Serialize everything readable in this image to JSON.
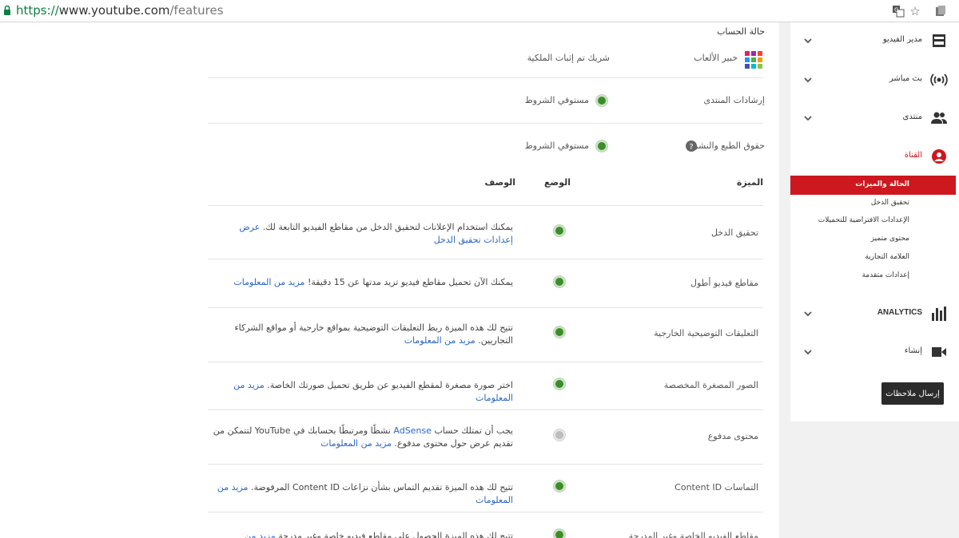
{
  "browser": {
    "url_scheme": "https://",
    "url_host": "www.youtube.com",
    "url_path": "/features",
    "icons": [
      "lock-icon",
      "translate-icon",
      "star-icon",
      "extension-icon"
    ]
  },
  "account": {
    "heading": "حالة الحساب",
    "games_expert": "خبير الألعاب",
    "ownership_partner": "شريك تم إثبات الملكية",
    "community_label": "إرشادات المنتدى",
    "community_status": "مستوفي الشروط",
    "copyright_label": "حقوق الطبع والنشر",
    "copyright_status": "مستوفي الشروط"
  },
  "table": {
    "col_feature": "الميزة",
    "col_status": "الوضع",
    "col_description": "الوصف",
    "rows": [
      {
        "feature": "تحقيق الدخل",
        "status": "on",
        "desc": "يمكنك استخدام الإعلانات لتحقيق الدخل من مقاطع الفيديو التابعة لك.",
        "link": "عرض إعدادات تحقيق الدخل"
      },
      {
        "feature": "مقاطع فيديو أطول",
        "status": "on",
        "desc": "يمكنك الآن تحميل مقاطع فيديو تزيد مدتها عن 15 دقيقة!",
        "link": "مزيد من المعلومات"
      },
      {
        "feature": "التعليقات التوضيحية الخارجية",
        "status": "on",
        "desc": "تتيح لك هذه الميزة ربط التعليقات التوضيحية بمواقع خارجية أو مواقع الشركاء التجاريين.",
        "link": "مزيد من المعلومات"
      },
      {
        "feature": "الصور المصغرة المخصصة",
        "status": "on",
        "desc": "اختر صورة مصغرة لمقطع الفيديو عن طريق تحميل صورتك الخاصة.",
        "link": "مزيد من المعلومات"
      },
      {
        "feature": "محتوى مدفوع",
        "status": "off",
        "desc_part1": "يجب أن تمتلك حساب",
        "desc_link_mid": "AdSense",
        "desc_part2": "نشطًا ومرتبطًا بحسابك في YouTube لتتمكن من تقديم عرض حول محتوى مدفوع.",
        "link": "مزيد من المعلومات"
      },
      {
        "feature": "التماسات Content ID",
        "status": "on",
        "desc": "تتيح لك هذه الميزة تقديم التماس بشأن نزاعات Content ID المرفوضة.",
        "link": "مزيد من المعلومات"
      },
      {
        "feature": "مقاطع الفيديو الخاصة وغير المدرجة",
        "status": "on",
        "desc": "تتيح لك هذه الميزة الحصول على مقاطع فيديو خاصة وغير مدرجة",
        "link": "مزيد من المعلومات"
      }
    ]
  },
  "sidebar": {
    "video_manager": "مدير الفيديو",
    "live": "بث مباشر",
    "community": "منتدى",
    "channel": "القناة",
    "channel_sub": [
      "الحالة والميزات",
      "تحقيق الدخل",
      "الإعدادات الافتراضية للتحميلات",
      "محتوى متميز",
      "العلامة التجارية",
      "إعدادات متقدمة"
    ],
    "analytics": "ANALYTICS",
    "create": "إنشاء",
    "feedback_button": "إرسال ملاحظات"
  },
  "colors": {
    "accent_red": "#cc181e",
    "status_green": "#3d8c2a",
    "status_gray": "#bdbdbd",
    "link_blue": "#2a66c4"
  }
}
